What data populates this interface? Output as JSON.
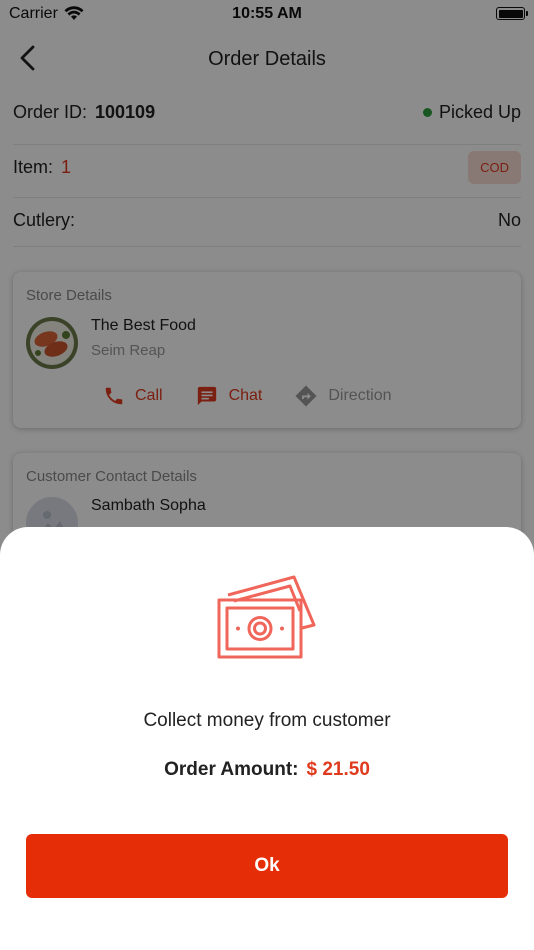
{
  "status_bar": {
    "carrier": "Carrier",
    "time": "10:55 AM"
  },
  "header": {
    "title": "Order Details"
  },
  "order": {
    "id_label": "Order ID:",
    "id_value": "100109",
    "status": "Picked Up",
    "item_label": "Item:",
    "item_count": "1",
    "payment_badge": "COD",
    "cutlery_label": "Cutlery:",
    "cutlery_value": "No"
  },
  "store_card": {
    "title": "Store Details",
    "name": "The Best Food",
    "location": "Seim Reap",
    "actions": {
      "call": "Call",
      "chat": "Chat",
      "direction": "Direction"
    }
  },
  "customer_card": {
    "title": "Customer Contact Details",
    "name": "Sambath Sopha"
  },
  "modal": {
    "message": "Collect money from customer",
    "amount_label": "Order Amount:",
    "amount_value": "$ 21.50",
    "ok_label": "Ok"
  },
  "colors": {
    "accent": "#E52E07",
    "status_green": "#2E9E3E",
    "icon_coral": "#F0665A"
  },
  "icons": [
    "back-icon",
    "wifi-icon",
    "battery-icon",
    "phone-icon",
    "chat-icon",
    "direction-icon",
    "money-icon"
  ]
}
